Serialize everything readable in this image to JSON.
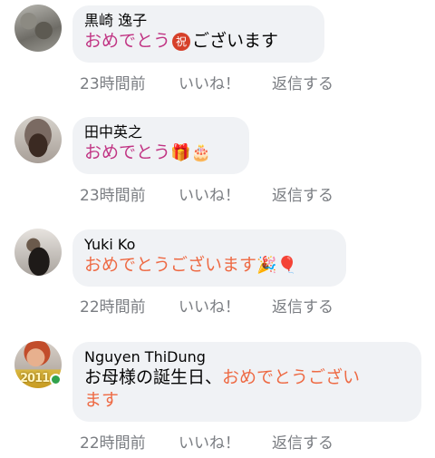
{
  "comments": [
    {
      "name": "黒崎 逸子",
      "text_a": "おめでとう",
      "badge": "祝",
      "text_b": "ございます",
      "time": "23時間前",
      "like": "いいね！",
      "reply": "返信する"
    },
    {
      "name": "田中英之",
      "text_a": "おめでとう",
      "emoji_gift": "🎁",
      "emoji_cake": "🎂",
      "time": "23時間前",
      "like": "いいね！",
      "reply": "返信する"
    },
    {
      "name": "Yuki Ko",
      "text_a": "おめでとうございます",
      "emoji_party": "🎉",
      "emoji_balloon": "🎈",
      "time": "22時間前",
      "like": "いいね！",
      "reply": "返信する"
    },
    {
      "name": "Nguyen ThiDung",
      "text_plain": "お母様の誕生日、",
      "text_a": "おめでとうござい",
      "text_b": "ます",
      "avatar_text": "2011",
      "time": "22時間前",
      "like": "いいね！",
      "reply": "返信する"
    }
  ]
}
